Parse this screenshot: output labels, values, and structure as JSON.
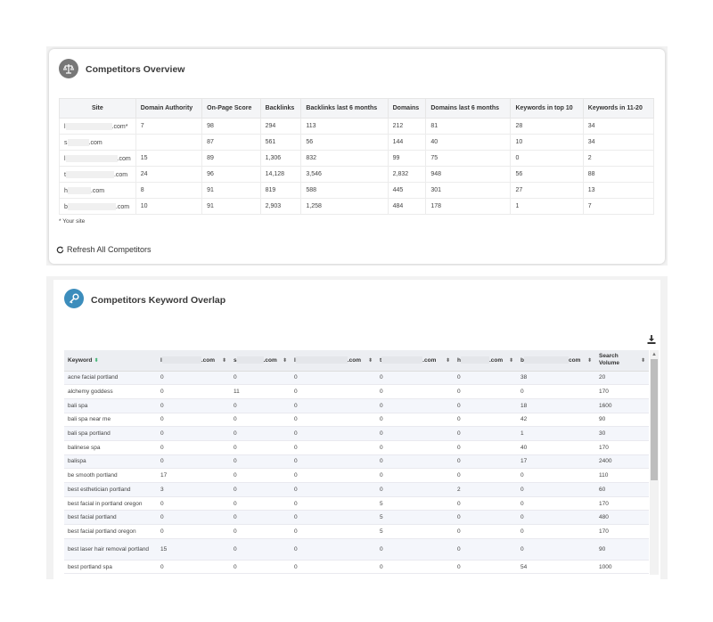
{
  "overview": {
    "title": "Competitors Overview",
    "icon": "scale-icon",
    "columns": [
      "Site",
      "Domain Authority",
      "On-Page Score",
      "Backlinks",
      "Backlinks last 6 months",
      "Domains",
      "Domains last 6 months",
      "Keywords in top 10",
      "Keywords in 11-20"
    ],
    "rows": [
      {
        "prefix": "l",
        "suffix": ".com*",
        "cells": [
          "7",
          "98",
          "294",
          "113",
          "212",
          "81",
          "28",
          "34"
        ]
      },
      {
        "prefix": "s",
        "suffix": ".com",
        "cells": [
          "",
          "87",
          "561",
          "56",
          "144",
          "40",
          "10",
          "34"
        ]
      },
      {
        "prefix": "l",
        "suffix": ".com",
        "cells": [
          "15",
          "89",
          "1,306",
          "832",
          "99",
          "75",
          "0",
          "2"
        ]
      },
      {
        "prefix": "t",
        "suffix": ".com",
        "cells": [
          "24",
          "96",
          "14,128",
          "3,546",
          "2,832",
          "948",
          "56",
          "88"
        ]
      },
      {
        "prefix": "h",
        "suffix": ".com",
        "cells": [
          "8",
          "91",
          "819",
          "588",
          "445",
          "301",
          "27",
          "13"
        ]
      },
      {
        "prefix": "b",
        "suffix": ".com",
        "cells": [
          "10",
          "91",
          "2,903",
          "1,258",
          "484",
          "178",
          "1",
          "7"
        ]
      }
    ],
    "note": "* Your site",
    "refresh_label": "Refresh All Competitors"
  },
  "overlap": {
    "title": "Competitors Keyword Overlap",
    "icon": "key-icon",
    "columns": [
      {
        "prefix": "Keyword",
        "suffix": ""
      },
      {
        "prefix": "l",
        "suffix": ".com"
      },
      {
        "prefix": "s",
        "suffix": ".com"
      },
      {
        "prefix": "l",
        "suffix": ".com"
      },
      {
        "prefix": "t",
        "suffix": ".com"
      },
      {
        "prefix": "h",
        "suffix": ".com"
      },
      {
        "prefix": "b",
        "suffix": "com"
      },
      {
        "prefix": "Search Volume",
        "suffix": ""
      }
    ],
    "rows": [
      [
        "acne facial portland",
        "0",
        "0",
        "0",
        "0",
        "0",
        "38",
        "20"
      ],
      [
        "alchemy goddess",
        "0",
        "11",
        "0",
        "0",
        "0",
        "0",
        "170"
      ],
      [
        "bali spa",
        "0",
        "0",
        "0",
        "0",
        "0",
        "18",
        "1600"
      ],
      [
        "bali spa near me",
        "0",
        "0",
        "0",
        "0",
        "0",
        "42",
        "90"
      ],
      [
        "bali spa portland",
        "0",
        "0",
        "0",
        "0",
        "0",
        "1",
        "30"
      ],
      [
        "balinese spa",
        "0",
        "0",
        "0",
        "0",
        "0",
        "40",
        "170"
      ],
      [
        "balispa",
        "0",
        "0",
        "0",
        "0",
        "0",
        "17",
        "2400"
      ],
      [
        "be smooth portland",
        "17",
        "0",
        "0",
        "0",
        "0",
        "0",
        "110"
      ],
      [
        "best esthetician portland",
        "3",
        "0",
        "0",
        "0",
        "2",
        "0",
        "60"
      ],
      [
        "best facial in portland oregon",
        "0",
        "0",
        "0",
        "5",
        "0",
        "0",
        "170"
      ],
      [
        "best facial portland",
        "0",
        "0",
        "0",
        "5",
        "0",
        "0",
        "480"
      ],
      [
        "best facial portland oregon",
        "0",
        "0",
        "0",
        "5",
        "0",
        "0",
        "170"
      ],
      [
        "best laser hair removal portland",
        "15",
        "0",
        "0",
        "0",
        "0",
        "0",
        "90"
      ],
      [
        "best portland spa",
        "0",
        "0",
        "0",
        "0",
        "0",
        "54",
        "1000"
      ]
    ]
  }
}
